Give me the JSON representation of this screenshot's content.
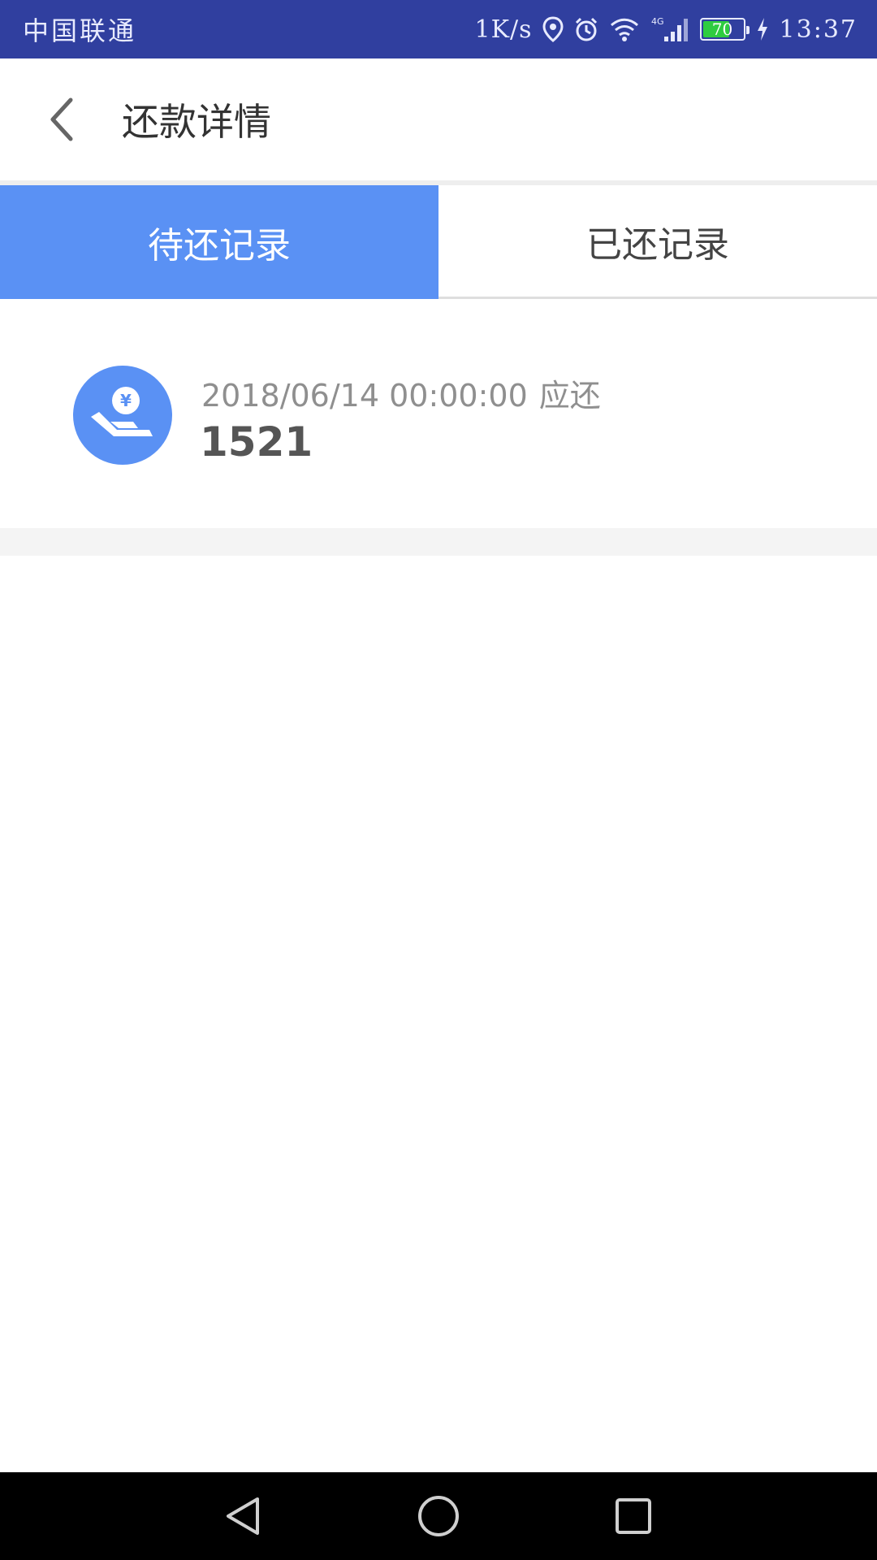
{
  "status_bar": {
    "carrier": "中国联通",
    "net_speed": "1K/s",
    "signal_type": "4G",
    "battery_level": 70,
    "battery_text": "70",
    "time": "13:37",
    "icons": [
      "location-icon",
      "alarm-icon",
      "wifi-icon",
      "signal-icon",
      "battery-icon",
      "charging-icon"
    ]
  },
  "header": {
    "title": "还款详情",
    "back_icon": "chevron-left-icon"
  },
  "tabs": [
    {
      "label": "待还记录",
      "active": true
    },
    {
      "label": "已还记录",
      "active": false
    }
  ],
  "records": [
    {
      "datetime": "2018/06/14 00:00:00",
      "due_label": "应还",
      "amount": "1521",
      "icon": "hand-yuan-icon"
    }
  ],
  "nav": {
    "icons": [
      "nav-back-icon",
      "nav-home-icon",
      "nav-recent-icon"
    ]
  },
  "colors": {
    "status_bar": "#303f9f",
    "accent": "#5a91f4",
    "battery": "#2ecc40"
  }
}
